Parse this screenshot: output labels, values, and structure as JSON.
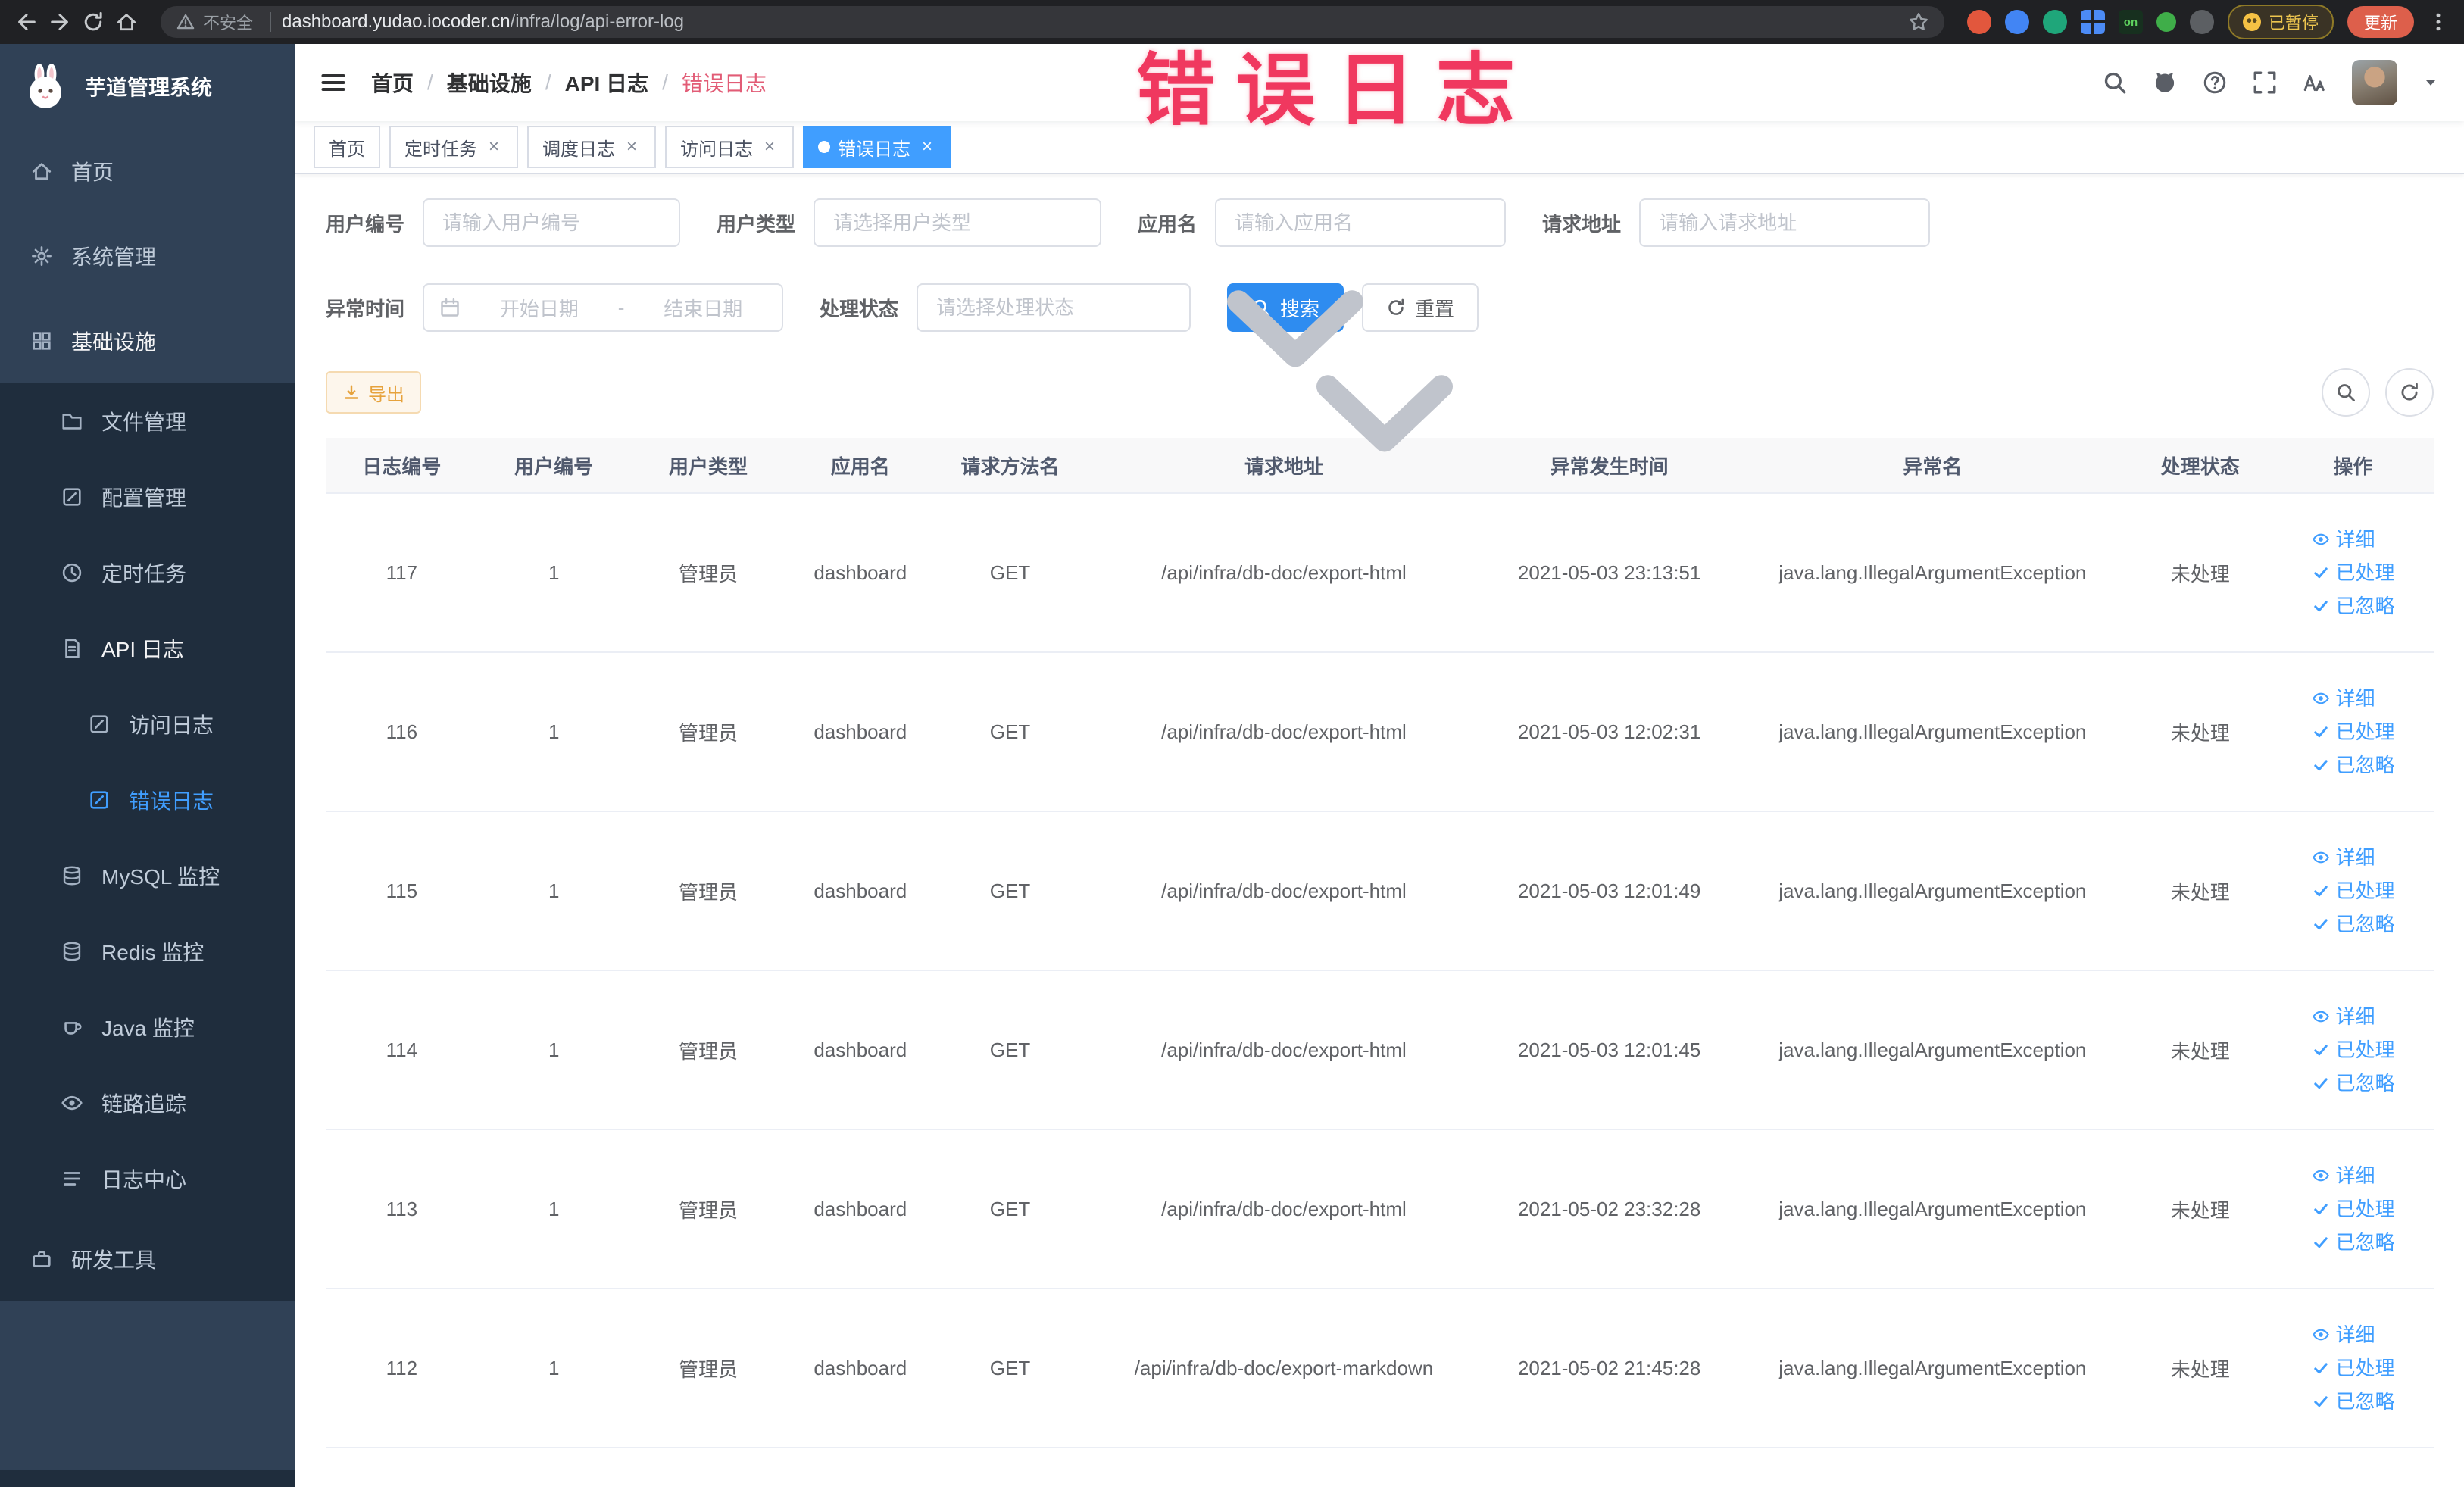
{
  "browser": {
    "security_label": "不安全",
    "url_domain": "dashboard.yudao.iocoder.cn",
    "url_path": "/infra/log/api-error-log",
    "extension_on_badge": "on",
    "paused_badge": "已暂停",
    "update_button": "更新"
  },
  "annotation": {
    "text": "错误日志",
    "color": "#f0385f"
  },
  "sidebar": {
    "title": "芋道管理系统",
    "items": [
      {
        "label": "首页"
      },
      {
        "label": "系统管理"
      },
      {
        "label": "基础设施"
      },
      {
        "label": "文件管理"
      },
      {
        "label": "配置管理"
      },
      {
        "label": "定时任务"
      },
      {
        "label": "API 日志"
      },
      {
        "label": "访问日志"
      },
      {
        "label": "错误日志"
      },
      {
        "label": "MySQL 监控"
      },
      {
        "label": "Redis 监控"
      },
      {
        "label": "Java 监控"
      },
      {
        "label": "链路追踪"
      },
      {
        "label": "日志中心"
      },
      {
        "label": "研发工具"
      }
    ]
  },
  "breadcrumb": {
    "separator": "/",
    "items": [
      "首页",
      "基础设施",
      "API 日志",
      "错误日志"
    ]
  },
  "tags": [
    {
      "label": "首页"
    },
    {
      "label": "定时任务"
    },
    {
      "label": "调度日志"
    },
    {
      "label": "访问日志"
    },
    {
      "label": "错误日志"
    }
  ],
  "filters": {
    "user_id": {
      "label": "用户编号",
      "placeholder": "请输入用户编号"
    },
    "user_type": {
      "label": "用户类型",
      "placeholder": "请选择用户类型"
    },
    "app_name": {
      "label": "应用名",
      "placeholder": "请输入应用名"
    },
    "request_url": {
      "label": "请求地址",
      "placeholder": "请输入请求地址"
    },
    "exception_time": {
      "label": "异常时间",
      "start_placeholder": "开始日期",
      "separator": "-",
      "end_placeholder": "结束日期"
    },
    "process_status": {
      "label": "处理状态",
      "placeholder": "请选择处理状态"
    },
    "search_button": "搜索",
    "reset_button": "重置"
  },
  "toolbar": {
    "export_button": "导出"
  },
  "table": {
    "columns": [
      "日志编号",
      "用户编号",
      "用户类型",
      "应用名",
      "请求方法名",
      "请求地址",
      "异常发生时间",
      "异常名",
      "处理状态",
      "操作"
    ],
    "actions": {
      "detail": "详细",
      "processed": "已处理",
      "ignored": "已忽略"
    },
    "rows": [
      {
        "id": "117",
        "user_id": "1",
        "user_type": "管理员",
        "app": "dashboard",
        "method": "GET",
        "url": "/api/infra/db-doc/export-html",
        "time": "2021-05-03 23:13:51",
        "exception": "java.lang.IllegalArgumentException",
        "status": "未处理"
      },
      {
        "id": "116",
        "user_id": "1",
        "user_type": "管理员",
        "app": "dashboard",
        "method": "GET",
        "url": "/api/infra/db-doc/export-html",
        "time": "2021-05-03 12:02:31",
        "exception": "java.lang.IllegalArgumentException",
        "status": "未处理"
      },
      {
        "id": "115",
        "user_id": "1",
        "user_type": "管理员",
        "app": "dashboard",
        "method": "GET",
        "url": "/api/infra/db-doc/export-html",
        "time": "2021-05-03 12:01:49",
        "exception": "java.lang.IllegalArgumentException",
        "status": "未处理"
      },
      {
        "id": "114",
        "user_id": "1",
        "user_type": "管理员",
        "app": "dashboard",
        "method": "GET",
        "url": "/api/infra/db-doc/export-html",
        "time": "2021-05-03 12:01:45",
        "exception": "java.lang.IllegalArgumentException",
        "status": "未处理"
      },
      {
        "id": "113",
        "user_id": "1",
        "user_type": "管理员",
        "app": "dashboard",
        "method": "GET",
        "url": "/api/infra/db-doc/export-html",
        "time": "2021-05-02 23:32:28",
        "exception": "java.lang.IllegalArgumentException",
        "status": "未处理"
      },
      {
        "id": "112",
        "user_id": "1",
        "user_type": "管理员",
        "app": "dashboard",
        "method": "GET",
        "url": "/api/infra/db-doc/export-markdown",
        "time": "2021-05-02 21:45:28",
        "exception": "java.lang.IllegalArgumentException",
        "status": "未处理"
      }
    ]
  },
  "colors": {
    "primary": "#409eff",
    "sidebar_bg": "#304156",
    "submenu_bg": "#1f2d3d",
    "warning": "#e6a23c",
    "annotation": "#f0385f",
    "active_tag": "#409eff"
  }
}
